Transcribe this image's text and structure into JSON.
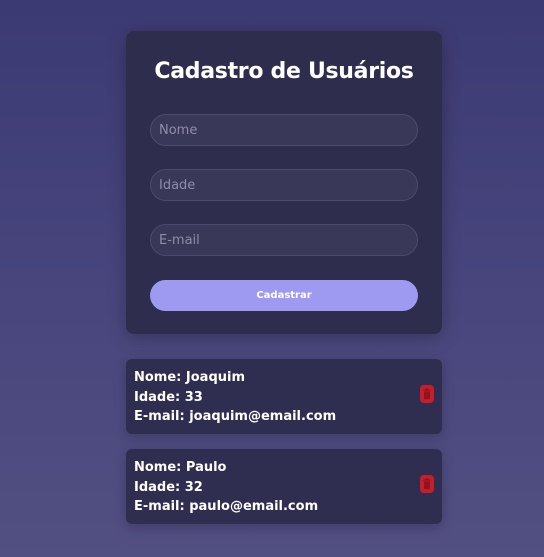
{
  "form": {
    "title": "Cadastro de Usuários",
    "fields": {
      "nome": {
        "placeholder": "Nome",
        "value": ""
      },
      "idade": {
        "placeholder": "Idade",
        "value": ""
      },
      "email": {
        "placeholder": "E-mail",
        "value": ""
      }
    },
    "submit_label": "Cadastrar"
  },
  "users": [
    {
      "nome": "Nome: Joaquim",
      "idade": "Idade: 33",
      "email": "E-mail: joaquim@email.com",
      "delete_icon": "trash-icon"
    },
    {
      "nome": "Nome: Paulo",
      "idade": "Idade: 32",
      "email": "E-mail: paulo@email.com",
      "delete_icon": "trash-icon"
    }
  ],
  "colors": {
    "accent": "#9e9af2",
    "card": "#2f2d4e",
    "danger": "#c81e2b"
  }
}
